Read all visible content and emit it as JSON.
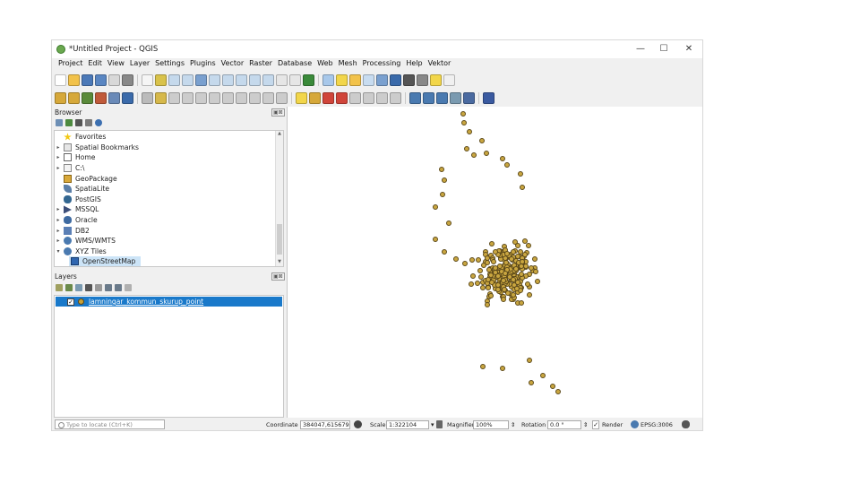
{
  "window": {
    "title": "*Untitled Project - QGIS",
    "min": "—",
    "max": "☐",
    "close": "✕"
  },
  "menu": [
    "Project",
    "Edit",
    "View",
    "Layer",
    "Settings",
    "Plugins",
    "Vector",
    "Raster",
    "Database",
    "Web",
    "Mesh",
    "Processing",
    "Help",
    "Vektor"
  ],
  "browser": {
    "title": "Browser",
    "close": "▣⊠",
    "items": [
      "Favorites",
      "Spatial Bookmarks",
      "Home",
      "C:\\",
      "GeoPackage",
      "SpatiaLite",
      "PostGIS",
      "MSSQL",
      "Oracle",
      "DB2",
      "WMS/WMTS",
      "XYZ Tiles",
      "OpenStreetMap"
    ]
  },
  "layers": {
    "title": "Layers",
    "close": "▣⊠",
    "layer_name": "lamningar_kommun_skurup_point",
    "checked": true,
    "colors": {
      "point_fill": "#c9a640",
      "point_stroke": "#5d4a1a",
      "selection": "#1979ca"
    }
  },
  "status": {
    "locator_placeholder": "Type to locate (Ctrl+K)",
    "coordinate_label": "Coordinate",
    "coordinate_value": "384047,6156793",
    "scale_label": "Scale",
    "scale_value": "1:322104",
    "magnifier_label": "Magnifier",
    "magnifier_value": "100%",
    "rotation_label": "Rotation",
    "rotation_value": "0.0 °",
    "render_label": "Render",
    "crs": "EPSG:3006"
  }
}
